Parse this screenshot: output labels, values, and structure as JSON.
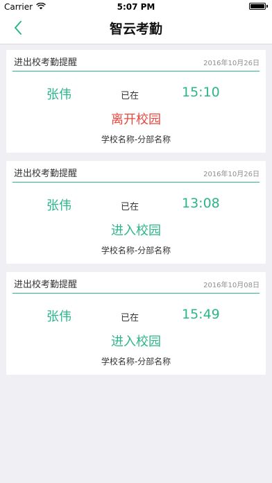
{
  "status_bar": {
    "carrier": "Carrier",
    "time": "5:07 PM",
    "battery_level": 1.0
  },
  "nav": {
    "title": "智云考勤",
    "back_icon": "chevron-left-icon"
  },
  "colors": {
    "accent": "#2bb58a",
    "leave": "#e8473e",
    "background": "#efeff4"
  },
  "records": [
    {
      "title": "进出校考勤提醒",
      "date": "2016年10月26日",
      "name": "张伟",
      "connector": "已在",
      "time": "15:10",
      "status": "离开校园",
      "status_type": "leave",
      "school": "学校名称-分部名称"
    },
    {
      "title": "进出校考勤提醒",
      "date": "2016年10月26日",
      "name": "张伟",
      "connector": "已在",
      "time": "13:08",
      "status": "进入校园",
      "status_type": "enter",
      "school": "学校名称-分部名称"
    },
    {
      "title": "进出校考勤提醒",
      "date": "2016年10月08日",
      "name": "张伟",
      "connector": "已在",
      "time": "15:49",
      "status": "进入校园",
      "status_type": "enter",
      "school": "学校名称-分部名称"
    }
  ]
}
